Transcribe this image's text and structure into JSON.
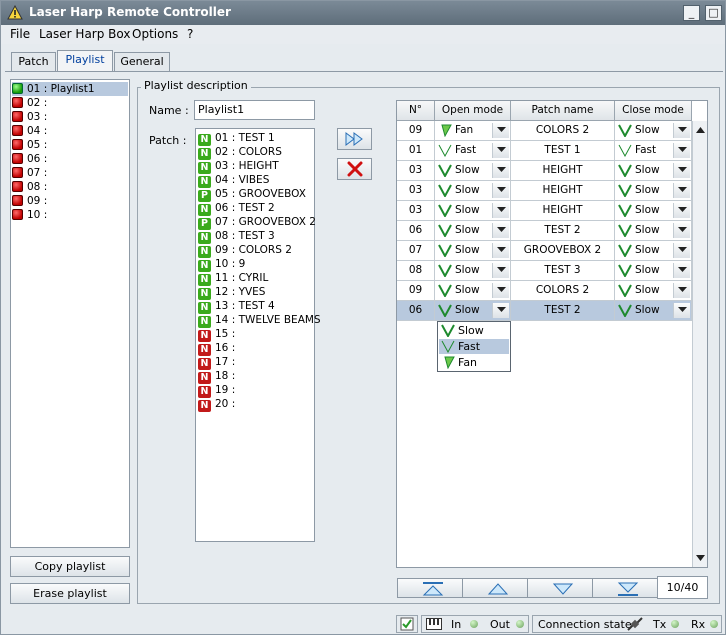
{
  "window": {
    "title": "Laser Harp Remote Controller",
    "controls": [
      "_",
      "□",
      "✕"
    ]
  },
  "menu": [
    "File",
    "Laser Harp Box",
    "Options",
    "?"
  ],
  "tabs": [
    {
      "label": "Patch",
      "active": false
    },
    {
      "label": "Playlist",
      "active": true
    },
    {
      "label": "General",
      "active": false
    }
  ],
  "playlists": [
    {
      "label": "01 : Playlist1",
      "state": "green",
      "selected": true
    },
    {
      "label": "02 :",
      "state": "red"
    },
    {
      "label": "03 :",
      "state": "red"
    },
    {
      "label": "04 :",
      "state": "red"
    },
    {
      "label": "05 :",
      "state": "red"
    },
    {
      "label": "06 :",
      "state": "red"
    },
    {
      "label": "07 :",
      "state": "red"
    },
    {
      "label": "08 :",
      "state": "red"
    },
    {
      "label": "09 :",
      "state": "red"
    },
    {
      "label": "10 :",
      "state": "red"
    }
  ],
  "buttons": {
    "copy": "Copy playlist",
    "erase": "Erase playlist"
  },
  "description": {
    "group_title": "Playlist description",
    "name_label": "Name :",
    "name_value": "Playlist1",
    "patch_label": "Patch :"
  },
  "patches": [
    {
      "badge": "N",
      "color": "green",
      "label": "01 : TEST 1"
    },
    {
      "badge": "N",
      "color": "green",
      "label": "02 : COLORS"
    },
    {
      "badge": "N",
      "color": "green",
      "label": "03 : HEIGHT"
    },
    {
      "badge": "N",
      "color": "green",
      "label": "04 : VIBES"
    },
    {
      "badge": "P",
      "color": "green",
      "label": "05 : GROOVEBOX"
    },
    {
      "badge": "N",
      "color": "green",
      "label": "06 : TEST 2"
    },
    {
      "badge": "P",
      "color": "green",
      "label": "07 : GROOVEBOX 2"
    },
    {
      "badge": "N",
      "color": "green",
      "label": "08 : TEST 3"
    },
    {
      "badge": "N",
      "color": "green",
      "label": "09 : COLORS 2"
    },
    {
      "badge": "N",
      "color": "green",
      "label": "10 : 9"
    },
    {
      "badge": "N",
      "color": "green",
      "label": "11 : CYRIL"
    },
    {
      "badge": "N",
      "color": "green",
      "label": "12 : YVES"
    },
    {
      "badge": "N",
      "color": "green",
      "label": "13 : TEST 4"
    },
    {
      "badge": "N",
      "color": "green",
      "label": "14 : TWELVE BEAMS"
    },
    {
      "badge": "N",
      "color": "red",
      "label": "15 :"
    },
    {
      "badge": "N",
      "color": "red",
      "label": "16 :"
    },
    {
      "badge": "N",
      "color": "red",
      "label": "17 :"
    },
    {
      "badge": "N",
      "color": "red",
      "label": "18 :"
    },
    {
      "badge": "N",
      "color": "red",
      "label": "19 :"
    },
    {
      "badge": "N",
      "color": "red",
      "label": "20 :"
    }
  ],
  "table": {
    "headers": [
      "N°",
      "Open mode",
      "Patch name",
      "Close mode"
    ],
    "rows": [
      {
        "n": "09",
        "open": "Fan",
        "patch": "COLORS 2",
        "close": "Slow"
      },
      {
        "n": "01",
        "open": "Fast",
        "patch": "TEST 1",
        "close": "Fast"
      },
      {
        "n": "03",
        "open": "Slow",
        "patch": "HEIGHT",
        "close": "Slow"
      },
      {
        "n": "03",
        "open": "Slow",
        "patch": "HEIGHT",
        "close": "Slow"
      },
      {
        "n": "03",
        "open": "Slow",
        "patch": "HEIGHT",
        "close": "Slow"
      },
      {
        "n": "06",
        "open": "Slow",
        "patch": "TEST 2",
        "close": "Slow"
      },
      {
        "n": "07",
        "open": "Slow",
        "patch": "GROOVEBOX 2",
        "close": "Slow"
      },
      {
        "n": "08",
        "open": "Slow",
        "patch": "TEST 3",
        "close": "Slow"
      },
      {
        "n": "09",
        "open": "Slow",
        "patch": "COLORS 2",
        "close": "Slow"
      },
      {
        "n": "06",
        "open": "Slow",
        "patch": "TEST 2",
        "close": "Slow",
        "selected": true
      }
    ],
    "dropdown_options": [
      {
        "label": "Slow"
      },
      {
        "label": "Fast",
        "highlighted": true
      },
      {
        "label": "Fan"
      }
    ]
  },
  "counter": "10/40",
  "status": {
    "in": "In",
    "out": "Out",
    "connection": "Connection state",
    "tx": "Tx",
    "rx": "Rx"
  },
  "colors": {
    "selection": "#b8c9de",
    "led_green": "#159a07",
    "led_red": "#c00000",
    "titlebar": "#6b7a87"
  }
}
